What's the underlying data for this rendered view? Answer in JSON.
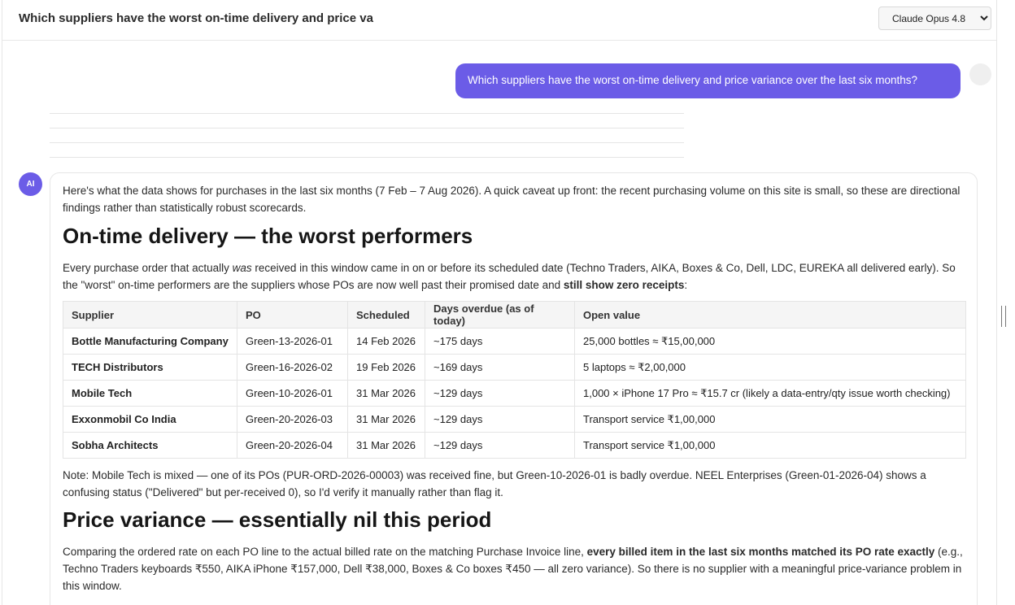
{
  "header": {
    "chat_title": "Which suppliers have the worst on-time delivery and price va",
    "model_selected": "Claude Opus 4.8"
  },
  "user_message": "Which suppliers have the worst on-time delivery and price variance over the last six months?",
  "assistant": {
    "avatar_label": "AI",
    "intro": "Here's what the data shows for purchases in the last six months (7 Feb – 7 Aug 2026). A quick caveat up front: the recent purchasing volume on this site is small, so these are directional findings rather than statistically robust scorecards.",
    "section1": {
      "heading": "On-time delivery — the worst performers",
      "para_a": "Every purchase order that actually ",
      "para_em": "was",
      "para_b": " received in this window came in on or before its scheduled date (Techno Traders, AIKA, Boxes & Co, Dell, LDC, EUREKA all delivered early). So the \"worst\" on-time performers are the suppliers whose POs are now well past their promised date and ",
      "para_strong": "still show zero receipts",
      "para_end": ":"
    },
    "table": {
      "headers": [
        "Supplier",
        "PO",
        "Scheduled",
        "Days overdue (as of today)",
        "Open value"
      ],
      "rows": [
        {
          "supplier": "Bottle Manufacturing Company",
          "po": "Green-13-2026-01",
          "scheduled": "14 Feb 2026",
          "overdue": "~175 days",
          "open_value": "25,000 bottles ≈ ₹15,00,000"
        },
        {
          "supplier": "TECH Distributors",
          "po": "Green-16-2026-02",
          "scheduled": "19 Feb 2026",
          "overdue": "~169 days",
          "open_value": "5 laptops ≈ ₹2,00,000"
        },
        {
          "supplier": "Mobile Tech",
          "po": "Green-10-2026-01",
          "scheduled": "31 Mar 2026",
          "overdue": "~129 days",
          "open_value": "1,000 × iPhone 17 Pro ≈ ₹15.7 cr (likely a data-entry/qty issue worth checking)"
        },
        {
          "supplier": "Exxonmobil Co India",
          "po": "Green-20-2026-03",
          "scheduled": "31 Mar 2026",
          "overdue": "~129 days",
          "open_value": "Transport service ₹1,00,000"
        },
        {
          "supplier": "Sobha Architects",
          "po": "Green-20-2026-04",
          "scheduled": "31 Mar 2026",
          "overdue": "~129 days",
          "open_value": "Transport service ₹1,00,000"
        }
      ]
    },
    "note": "Note: Mobile Tech is mixed — one of its POs (PUR-ORD-2026-00003) was received fine, but Green-10-2026-01 is badly overdue. NEEL Enterprises (Green-01-2026-04) shows a confusing status (\"Delivered\" but per-received 0), so I'd verify it manually rather than flag it.",
    "section2": {
      "heading": "Price variance — essentially nil this period",
      "para_a": "Comparing the ordered rate on each PO line to the actual billed rate on the matching Purchase Invoice line, ",
      "para_strong": "every billed item in the last six months matched its PO rate exactly",
      "para_b": " (e.g., Techno Traders keyboards ₹550, AIKA iPhone ₹157,000, Dell ₹38,000, Boxes & Co boxes ₹450 — all zero variance). So there is no supplier with a meaningful price-variance problem in this window."
    }
  },
  "colors": {
    "accent": "#6b5ce7",
    "table_header_bg": "#f5f5f5"
  }
}
